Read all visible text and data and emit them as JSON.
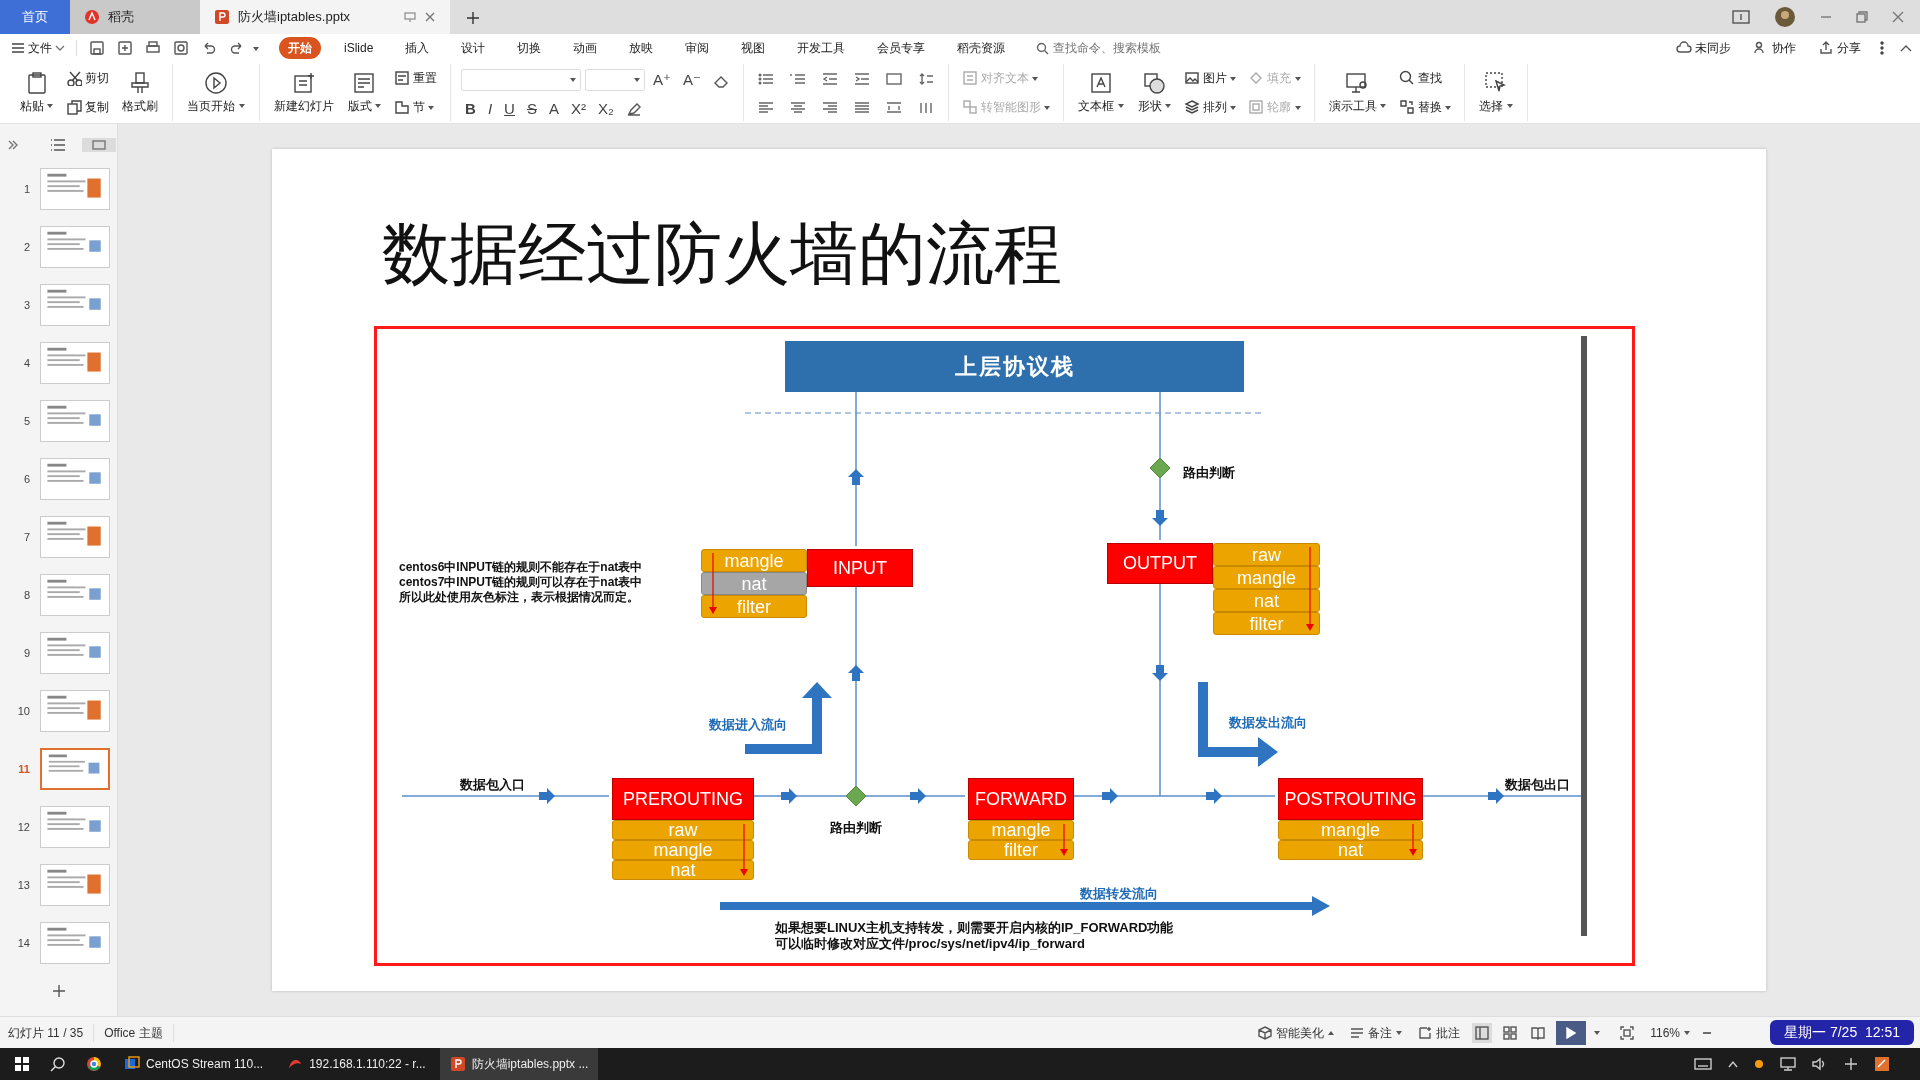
{
  "tabs": [
    {
      "label": "首页",
      "kind": "home",
      "selected": false
    },
    {
      "label": "稻壳",
      "kind": "app",
      "selected": false
    },
    {
      "label": "防火墙iptables.pptx",
      "kind": "doc",
      "selected": true
    }
  ],
  "menu": {
    "file": "文件",
    "tabs": [
      {
        "label": "开始",
        "selected": true
      },
      {
        "label": "iSlide",
        "selected": false
      },
      {
        "label": "插入",
        "selected": false
      },
      {
        "label": "设计",
        "selected": false
      },
      {
        "label": "切换",
        "selected": false
      },
      {
        "label": "动画",
        "selected": false
      },
      {
        "label": "放映",
        "selected": false
      },
      {
        "label": "审阅",
        "selected": false
      },
      {
        "label": "视图",
        "selected": false
      },
      {
        "label": "开发工具",
        "selected": false
      },
      {
        "label": "会员专享",
        "selected": false
      },
      {
        "label": "稻壳资源",
        "selected": false
      }
    ],
    "search": {
      "placeholder": "查找命令、搜索模板"
    },
    "actions": [
      "未同步",
      "协作",
      "分享"
    ]
  },
  "ribbon": [
    {
      "kind": "buttons",
      "columns": [
        [
          {
            "label": "粘贴",
            "dropdown": true,
            "disabled": false
          }
        ],
        [
          {
            "label": "剪切",
            "dropdown": false,
            "disabled": false
          },
          {
            "label": "复制",
            "dropdown": false,
            "disabled": false
          }
        ],
        [
          {
            "label": "格式刷",
            "dropdown": false,
            "disabled": false
          }
        ]
      ]
    },
    {
      "kind": "buttons",
      "columns": [
        [
          {
            "label": "当页开始",
            "dropdown": true,
            "disabled": false
          }
        ]
      ]
    },
    {
      "kind": "buttons",
      "columns": [
        [
          {
            "label": "新建幻灯片",
            "dropdown": false,
            "disabled": false
          }
        ],
        [
          {
            "label": "版式",
            "dropdown": true,
            "disabled": false
          }
        ],
        [
          {
            "label": "重置",
            "dropdown": false,
            "disabled": false
          },
          {
            "label": "节",
            "dropdown": true,
            "disabled": false
          }
        ]
      ]
    },
    {
      "kind": "font",
      "size_marks": [
        "A⁺",
        "A⁻"
      ],
      "format_marks": [
        "B",
        "I",
        "U",
        "S",
        "A",
        "X²",
        "X₂"
      ]
    },
    {
      "kind": "paragraph"
    },
    {
      "kind": "buttons",
      "columns": [
        [
          {
            "label": "对齐文本",
            "dropdown": true,
            "disabled": true
          },
          {
            "label": "转智能图形",
            "dropdown": true,
            "disabled": true
          }
        ]
      ]
    },
    {
      "kind": "buttons",
      "columns": [
        [
          {
            "label": "文本框",
            "dropdown": true,
            "disabled": false
          }
        ],
        [
          {
            "label": "形状",
            "dropdown": true,
            "disabled": false
          }
        ],
        [
          {
            "label": "图片",
            "dropdown": true,
            "disabled": false
          },
          {
            "label": "排列",
            "dropdown": true,
            "disabled": false
          }
        ],
        [
          {
            "label": "填充",
            "dropdown": true,
            "disabled": true
          },
          {
            "label": "轮廓",
            "dropdown": true,
            "disabled": true
          }
        ]
      ]
    },
    {
      "kind": "buttons",
      "columns": [
        [
          {
            "label": "演示工具",
            "dropdown": true,
            "disabled": false
          }
        ],
        [
          {
            "label": "查找",
            "dropdown": false,
            "disabled": false
          },
          {
            "label": "替换",
            "dropdown": true,
            "disabled": false
          }
        ]
      ]
    },
    {
      "kind": "buttons",
      "columns": [
        [
          {
            "label": "选择",
            "dropdown": true,
            "disabled": false
          }
        ]
      ]
    }
  ],
  "thumbnails": [
    {
      "number": "1",
      "selected": false
    },
    {
      "number": "2",
      "selected": false
    },
    {
      "number": "3",
      "selected": false
    },
    {
      "number": "4",
      "selected": false
    },
    {
      "number": "5",
      "selected": false
    },
    {
      "number": "6",
      "selected": false
    },
    {
      "number": "7",
      "selected": false
    },
    {
      "number": "8",
      "selected": false
    },
    {
      "number": "9",
      "selected": false
    },
    {
      "number": "10",
      "selected": false
    },
    {
      "number": "11",
      "selected": true
    },
    {
      "number": "12",
      "selected": false
    },
    {
      "number": "13",
      "selected": false
    },
    {
      "number": "14",
      "selected": false
    }
  ],
  "slide": {
    "title": "数据经过防火墙的流程",
    "top_box": "上层协议栈",
    "chains": [
      {
        "name": "INPUT",
        "tables": [
          {
            "label": "mangle",
            "grayed": false
          },
          {
            "label": "nat",
            "grayed": true
          },
          {
            "label": "filter",
            "grayed": false
          }
        ]
      },
      {
        "name": "OUTPUT",
        "tables": [
          {
            "label": "raw",
            "grayed": false
          },
          {
            "label": "mangle",
            "grayed": false
          },
          {
            "label": "nat",
            "grayed": false
          },
          {
            "label": "filter",
            "grayed": false
          }
        ]
      },
      {
        "name": "PREROUTING",
        "tables": [
          {
            "label": "raw",
            "grayed": false
          },
          {
            "label": "mangle",
            "grayed": false
          },
          {
            "label": "nat",
            "grayed": false
          }
        ]
      },
      {
        "name": "FORWARD",
        "tables": [
          {
            "label": "mangle",
            "grayed": false
          },
          {
            "label": "filter",
            "grayed": false
          }
        ]
      },
      {
        "name": "POSTROUTING",
        "tables": [
          {
            "label": "mangle",
            "grayed": false
          },
          {
            "label": "nat",
            "grayed": false
          }
        ]
      }
    ],
    "route_top": "路由判断",
    "route_bottom": "路由判断",
    "entry": "数据包入口",
    "exit": "数据包出口",
    "flow_in": "数据进入流向",
    "flow_out": "数据发出流向",
    "flow_forward": "数据转发流向",
    "input_note": [
      "centos6中INPUT链的规则不能存在于nat表中",
      "centos7中INPUT链的规则可以存在于nat表中",
      "所以此处使用灰色标注，表示根据情况而定。"
    ],
    "forward_note": [
      "如果想要LINUX主机支持转发，则需要开启内核的IP_FORWARD功能",
      "可以临时修改对应文件/proc/sys/net/ipv4/ip_forward"
    ]
  },
  "status_bar": {
    "slide_info": "幻灯片 11 / 35",
    "theme": "Office 主题",
    "beautify": "智能美化",
    "notes": "备注",
    "comments": "批注",
    "zoom": "116%"
  },
  "clock": "星期一 7/25  12:51",
  "taskbar": {
    "apps": [
      {
        "label": "CentOS Stream 110...",
        "selected": false
      },
      {
        "label": "192.168.1.110:22 - r...",
        "selected": false
      },
      {
        "label": "防火墙iptables.pptx ...",
        "selected": true
      }
    ]
  }
}
